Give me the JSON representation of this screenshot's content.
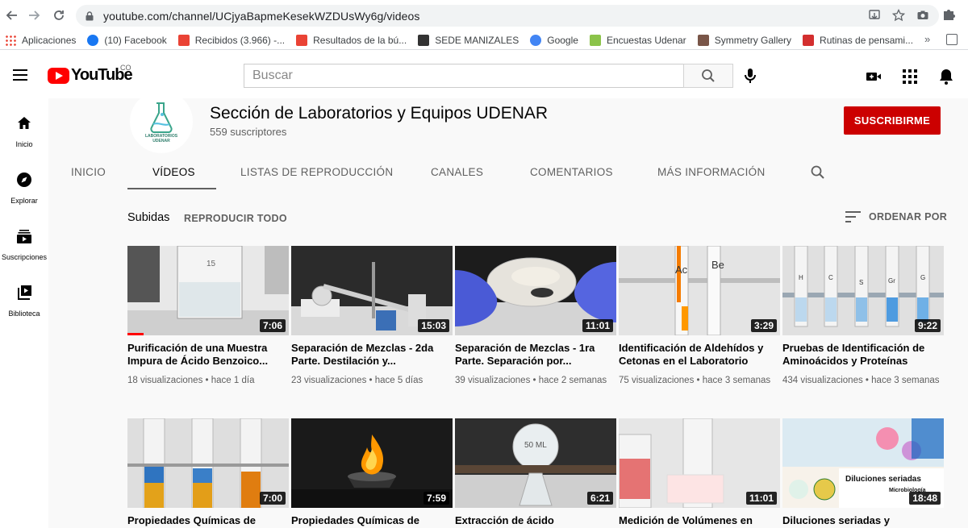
{
  "browser": {
    "url": "youtube.com/channel/UCjyaBapmeKesekWZDUsWy6g/videos",
    "bookmarks": [
      {
        "label": "Aplicaciones",
        "icon": "apps-grid-icon",
        "color": "#4285f4"
      },
      {
        "label": "(10) Facebook",
        "icon": "facebook-icon",
        "color": "#1877f2"
      },
      {
        "label": "Recibidos (3.966) -...",
        "icon": "gmail-icon",
        "color": "#ea4335"
      },
      {
        "label": "Resultados de la bú...",
        "icon": "gmail-icon",
        "color": "#ea4335"
      },
      {
        "label": "SEDE MANIZALES",
        "icon": "un-logo-icon",
        "color": "#333333"
      },
      {
        "label": "Google",
        "icon": "google-icon",
        "color": "#4285f4"
      },
      {
        "label": "Encuestas Udenar",
        "icon": "leaf-icon",
        "color": "#8bc34a"
      },
      {
        "label": "Symmetry Gallery",
        "icon": "symmetry-icon",
        "color": "#795548"
      },
      {
        "label": "Rutinas de pensami...",
        "icon": "bookmark-red-icon",
        "color": "#d32f2f"
      }
    ]
  },
  "youtube": {
    "logo_text": "YouTube",
    "country_code": "CO",
    "search_placeholder": "Buscar",
    "guide": [
      {
        "label": "Inicio",
        "icon": "home-icon"
      },
      {
        "label": "Explorar",
        "icon": "compass-icon"
      },
      {
        "label": "Suscripciones",
        "icon": "subscriptions-icon"
      },
      {
        "label": "Biblioteca",
        "icon": "library-icon"
      }
    ]
  },
  "channel": {
    "name": "Sección de Laboratorios y Equipos UDENAR",
    "subscribers": "559 suscriptores",
    "subscribe_label": "SUSCRIBIRME",
    "avatar_text": "LABORATORIOS UDENAR",
    "tabs": [
      "INICIO",
      "VÍDEOS",
      "LISTAS DE REPRODUCCIÓN",
      "CANALES",
      "COMENTARIOS",
      "MÁS INFORMACIÓN"
    ],
    "active_tab": "VÍDEOS"
  },
  "videos_section": {
    "label": "Subidas",
    "play_all": "REPRODUCIR TODO",
    "sort_label": "ORDENAR POR"
  },
  "videos": [
    {
      "title": "Purificación de una Muestra Impura de Ácido Benzoico...",
      "views": "18 visualizaciones",
      "age": "hace 1 día",
      "duration": "7:06",
      "watched": 0.1
    },
    {
      "title": "Separación de Mezclas - 2da Parte. Destilación y...",
      "views": "23 visualizaciones",
      "age": "hace 5 días",
      "duration": "15:03"
    },
    {
      "title": "Separación de Mezclas - 1ra Parte. Separación por...",
      "views": "39 visualizaciones",
      "age": "hace 2 semanas",
      "duration": "11:01"
    },
    {
      "title": "Identificación de Aldehídos y Cetonas en el Laboratorio",
      "views": "75 visualizaciones",
      "age": "hace 3 semanas",
      "duration": "3:29"
    },
    {
      "title": "Pruebas de Identificación de Aminoácidos y Proteínas",
      "views": "434 visualizaciones",
      "age": "hace 3 semanas",
      "duration": "9:22"
    },
    {
      "title": "Propiedades Químicas de",
      "views": "",
      "age": "",
      "duration": "7:00"
    },
    {
      "title": "Propiedades Químicas de",
      "views": "",
      "age": "",
      "duration": "7:59"
    },
    {
      "title": "Extracción de ácido",
      "views": "",
      "age": "",
      "duration": "6:21"
    },
    {
      "title": "Medición de Volúmenes en",
      "views": "",
      "age": "",
      "duration": "11:01"
    },
    {
      "title": "Diluciones seriadas y",
      "views": "",
      "age": "",
      "duration": "18:48"
    }
  ],
  "thumb_text": {
    "v0_mark": "15",
    "v3_label_a": "Ac",
    "v3_label_b": "Be",
    "v4_labels": [
      "H",
      "C",
      "S",
      "Gr",
      "G"
    ],
    "v7_mark": "50 ML",
    "v9_title": "Diluciones seriadas",
    "v9_sub": "Microbiología"
  }
}
